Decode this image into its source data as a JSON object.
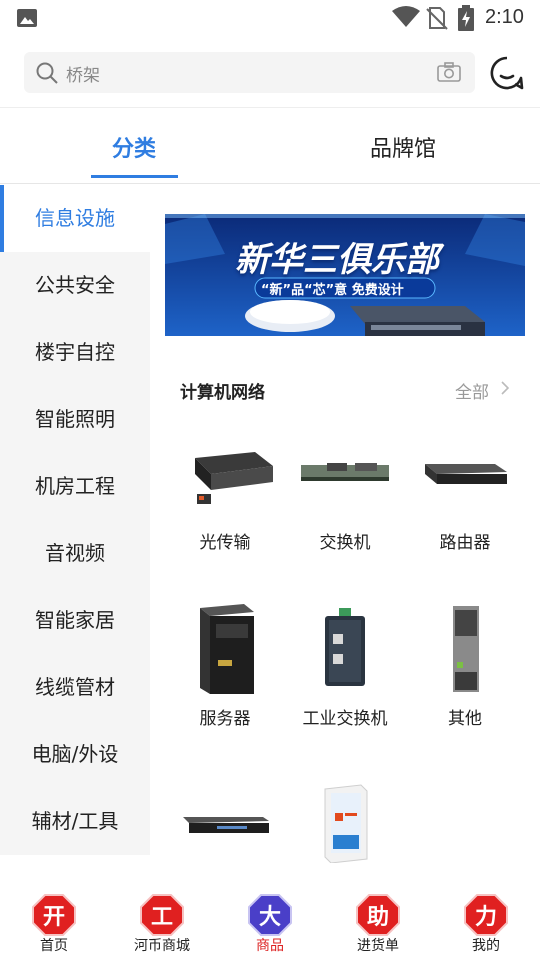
{
  "status_bar": {
    "time": "2:10"
  },
  "search": {
    "placeholder": "桥架"
  },
  "tabs": [
    {
      "label": "分类",
      "active": true
    },
    {
      "label": "品牌馆",
      "active": false
    }
  ],
  "sidebar": {
    "items": [
      {
        "label": "信息设施",
        "active": true
      },
      {
        "label": "公共安全"
      },
      {
        "label": "楼宇自控"
      },
      {
        "label": "智能照明"
      },
      {
        "label": "机房工程"
      },
      {
        "label": "音视频"
      },
      {
        "label": "智能家居"
      },
      {
        "label": "线缆管材"
      },
      {
        "label": "电脑/外设"
      },
      {
        "label": "辅材/工具"
      }
    ]
  },
  "banner": {
    "title": "新华三俱乐部",
    "subtitle": "“新”品“芯”意 免费设计"
  },
  "section": {
    "title": "计算机网络",
    "more_label": "全部"
  },
  "products": [
    {
      "label": "光传输",
      "icon": "optical-transceiver-icon"
    },
    {
      "label": "交换机",
      "icon": "switch-card-icon"
    },
    {
      "label": "路由器",
      "icon": "router-icon"
    },
    {
      "label": "服务器",
      "icon": "tower-server-icon"
    },
    {
      "label": "工业交换机",
      "icon": "industrial-switch-icon"
    },
    {
      "label": "其他",
      "icon": "power-module-icon"
    },
    {
      "label": "",
      "icon": "rack-device-icon"
    },
    {
      "label": "",
      "icon": "office-software-icon"
    }
  ],
  "bottom_nav": {
    "items": [
      {
        "badge": "开",
        "label": "首页",
        "color": "#e02020"
      },
      {
        "badge": "工",
        "label": "河币商城",
        "color": "#e02020"
      },
      {
        "badge": "大",
        "label": "商品",
        "color": "#4a3fc8",
        "active": true
      },
      {
        "badge": "助",
        "label": "进货单",
        "color": "#e02020"
      },
      {
        "badge": "力",
        "label": "我的",
        "color": "#e02020"
      }
    ]
  },
  "colors": {
    "accent": "#2f7de1",
    "nav_active": "#dd2222"
  }
}
